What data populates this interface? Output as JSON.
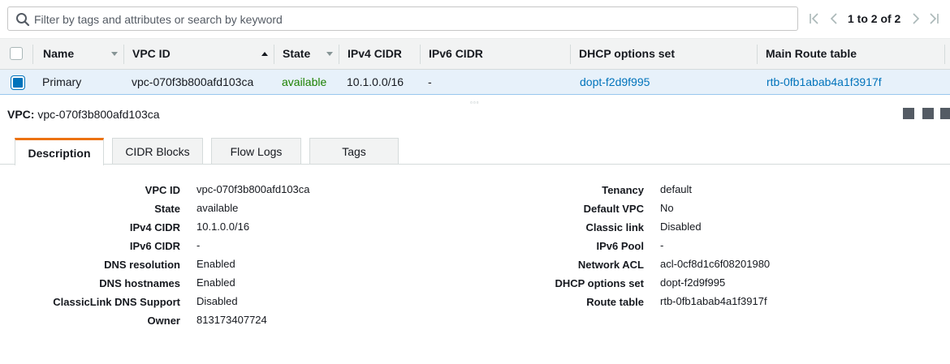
{
  "filter": {
    "placeholder": "Filter by tags and attributes or search by keyword"
  },
  "pagination": {
    "label": "1 to 2 of 2"
  },
  "table": {
    "columns": [
      "Name",
      "VPC ID",
      "State",
      "IPv4 CIDR",
      "IPv6 CIDR",
      "DHCP options set",
      "Main Route table"
    ],
    "rows": [
      {
        "name": "Primary",
        "vpc_id": "vpc-070f3b800afd103ca",
        "state": "available",
        "ipv4_cidr": "10.1.0.0/16",
        "ipv6_cidr": "-",
        "dhcp_options_set": "dopt-f2d9f995",
        "main_route_table": "rtb-0fb1abab4a1f3917f"
      }
    ]
  },
  "detail": {
    "prefix": "VPC:",
    "vpc_id": "vpc-070f3b800afd103ca",
    "tabs": [
      "Description",
      "CIDR Blocks",
      "Flow Logs",
      "Tags"
    ],
    "left": [
      {
        "label": "VPC ID",
        "value": "vpc-070f3b800afd103ca"
      },
      {
        "label": "State",
        "value": "available"
      },
      {
        "label": "IPv4 CIDR",
        "value": "10.1.0.0/16"
      },
      {
        "label": "IPv6 CIDR",
        "value": "-"
      },
      {
        "label": "DNS resolution",
        "value": "Enabled"
      },
      {
        "label": "DNS hostnames",
        "value": "Enabled"
      },
      {
        "label": "ClassicLink DNS Support",
        "value": "Disabled"
      },
      {
        "label": "Owner",
        "value": "813173407724"
      }
    ],
    "right": [
      {
        "label": "Tenancy",
        "value": "default"
      },
      {
        "label": "Default VPC",
        "value": "No"
      },
      {
        "label": "Classic link",
        "value": "Disabled"
      },
      {
        "label": "IPv6 Pool",
        "value": "-"
      },
      {
        "label": "Network ACL",
        "value": "acl-0cf8d1c6f08201980"
      },
      {
        "label": "DHCP options set",
        "value": "dopt-f2d9f995"
      },
      {
        "label": "Route table",
        "value": "rtb-0fb1abab4a1f3917f"
      }
    ]
  },
  "colors": {
    "link": "#0073bb",
    "available": "#1d8102",
    "active_tab_accent": "#ec7211",
    "selected_row": "#e7f1fa"
  },
  "icons": [
    "search-icon",
    "first-page-icon",
    "prev-page-icon",
    "next-page-icon",
    "last-page-icon",
    "sort-icon",
    "panel-layout-icon"
  ]
}
